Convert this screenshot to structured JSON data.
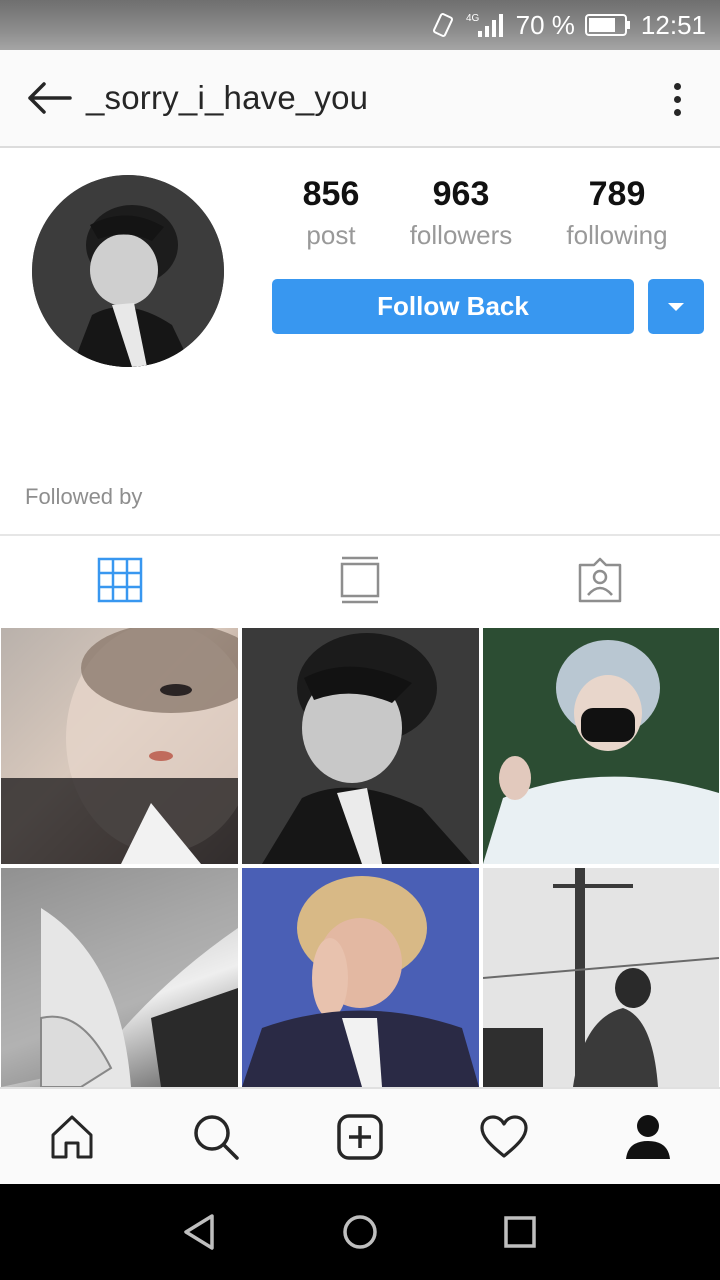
{
  "status_bar": {
    "network": "4G",
    "battery_percent": "70 %",
    "time": "12:51"
  },
  "header": {
    "username": "_sorry_i_have_you"
  },
  "profile": {
    "stats": [
      {
        "value": "856",
        "label": "post"
      },
      {
        "value": "963",
        "label": "followers"
      },
      {
        "value": "789",
        "label": "following"
      }
    ],
    "follow_button_label": "Follow Back",
    "followed_by_label": "Followed by"
  },
  "tabs": [
    {
      "icon": "grid-icon",
      "active": true
    },
    {
      "icon": "feed-icon",
      "active": false
    },
    {
      "icon": "tagged-icon",
      "active": false
    }
  ],
  "grid_photos": 6,
  "bottom_nav": [
    {
      "icon": "home-icon"
    },
    {
      "icon": "search-icon"
    },
    {
      "icon": "add-icon"
    },
    {
      "icon": "heart-icon"
    },
    {
      "icon": "profile-icon",
      "active": true
    }
  ],
  "colors": {
    "accent": "#3897f0",
    "text_primary": "#262626",
    "text_secondary": "#999999"
  }
}
